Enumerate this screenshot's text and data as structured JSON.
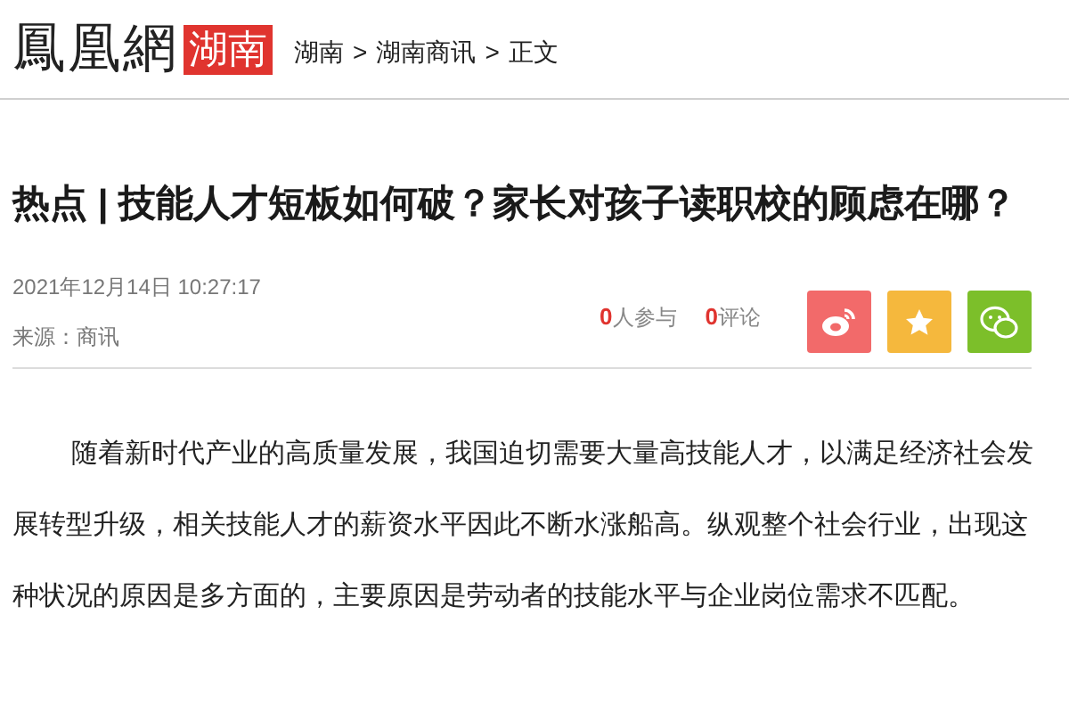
{
  "header": {
    "logo": "鳳凰網",
    "region_badge": "湖南",
    "breadcrumb": [
      "湖南",
      "湖南商讯",
      "正文"
    ],
    "separator": ">"
  },
  "article": {
    "title": "热点 | 技能人才短板如何破？家长对孩子读职校的顾虑在哪？",
    "date": "2021年12月14日 10:27:17",
    "source": "来源：商讯",
    "participants": {
      "count": "0",
      "label": "人参与"
    },
    "comments": {
      "count": "0",
      "label": "评论"
    },
    "share_buttons": [
      {
        "kind": "weibo",
        "color": "#f26a6a"
      },
      {
        "kind": "favorite",
        "color": "#f5b83d"
      },
      {
        "kind": "wechat",
        "color": "#7cbf2a"
      }
    ],
    "paragraphs": [
      "随着新时代产业的高质量发展，我国迫切需要大量高技能人才，以满足经济社会发展转型升级，相关技能人才的薪资水平因此不断水涨船高。纵观整个社会行业，出现这种状况的原因是多方面的，主要原因是劳动者的技能水平与企业岗位需求不匹配。"
    ]
  }
}
